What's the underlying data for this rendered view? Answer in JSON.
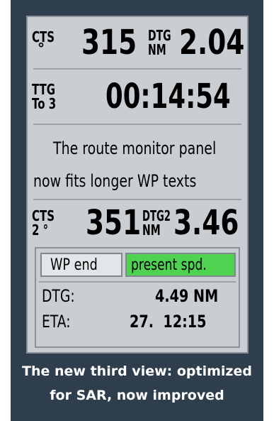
{
  "route_monitor": {
    "row1": {
      "label_top": "CTS",
      "label_bottom": "°",
      "value": "315",
      "unit_top": "DTG",
      "unit_bottom": "NM",
      "value2": "2.04"
    },
    "row2": {
      "label_top": "TTG",
      "label_bottom": "To 3",
      "value": "00:14:54"
    },
    "message_line1": "The route monitor panel",
    "message_line2": "now fits longer WP texts",
    "row3": {
      "label_top": "CTS",
      "label_bottom": "2 °",
      "value": "351",
      "unit_top": "DTG2",
      "unit_bottom": "NM",
      "value2": "3.46"
    },
    "buttons": {
      "wp_end": "WP end",
      "present_spd": "present spd."
    },
    "info": {
      "dtg_label": "DTG:",
      "dtg_value": "4.49 NM",
      "eta_label": "ETA:",
      "eta_value": "27.  12:15"
    }
  },
  "caption": {
    "line1": "The new third view: optimized",
    "line2": "for SAR, now improved"
  },
  "colors": {
    "frame": "#2f3e4d",
    "panel": "#c9ced3",
    "active_button": "#4fd24f"
  }
}
